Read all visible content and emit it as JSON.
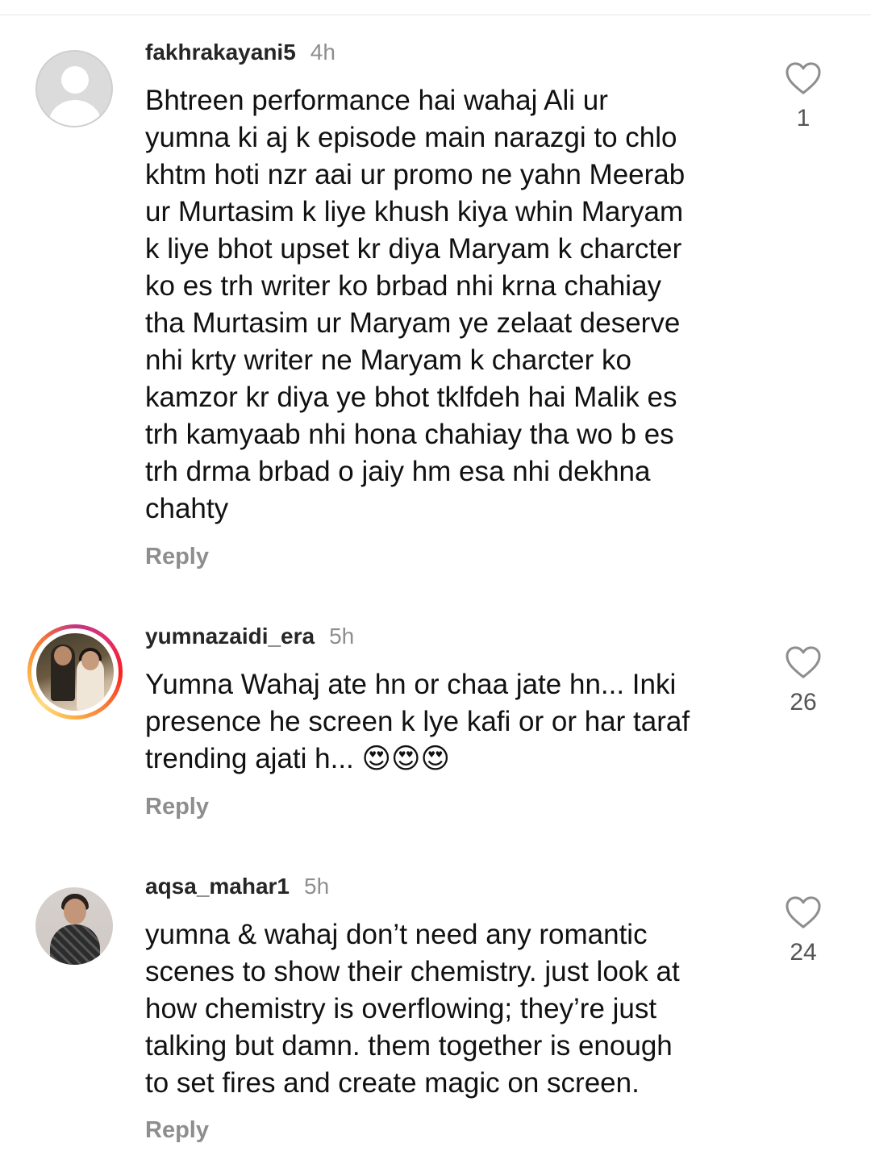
{
  "comments": [
    {
      "username": "fakhrakayani5",
      "time": "4h",
      "text": "Bhtreen performance hai wahaj Ali ur\nyumna ki aj k episode main narazgi to chlo\nkhtm hoti nzr aai ur promo ne yahn Meerab\nur Murtasim k liye khush kiya whin Maryam\nk liye bhot upset kr diya Maryam k charcter\nko es trh writer ko brbad nhi krna chahiay\ntha Murtasim ur Maryam ye zelaat deserve\nnhi krty writer ne Maryam k charcter ko\nkamzor kr diya ye bhot tklfdeh hai Malik es\ntrh kamyaab nhi hona chahiay tha wo b es\ntrh drma brbad o jaiy hm esa nhi dekhna\nchahty",
      "likes": "1",
      "reply_label": "Reply"
    },
    {
      "username": "yumnazaidi_era",
      "time": "5h",
      "text": "Yumna Wahaj ate hn or chaa jate hn... Inki\npresence he screen k lye kafi or or har taraf\ntrending ajati h... 😍😍😍",
      "likes": "26",
      "reply_label": "Reply"
    },
    {
      "username": "aqsa_mahar1",
      "time": "5h",
      "text": "yumna & wahaj don’t need any romantic\nscenes to show their chemistry. just look at\nhow chemistry is overflowing; they’re just\ntalking but damn. them together is enough\nto set fires and create magic on screen.",
      "likes": "24",
      "reply_label": "Reply"
    }
  ],
  "icons": {
    "like": "heart-outline-icon"
  },
  "colors": {
    "text": "#111111",
    "secondary": "#8e8e8e",
    "story_ring_start": "#c13584",
    "story_ring_end": "#fcaf45"
  }
}
